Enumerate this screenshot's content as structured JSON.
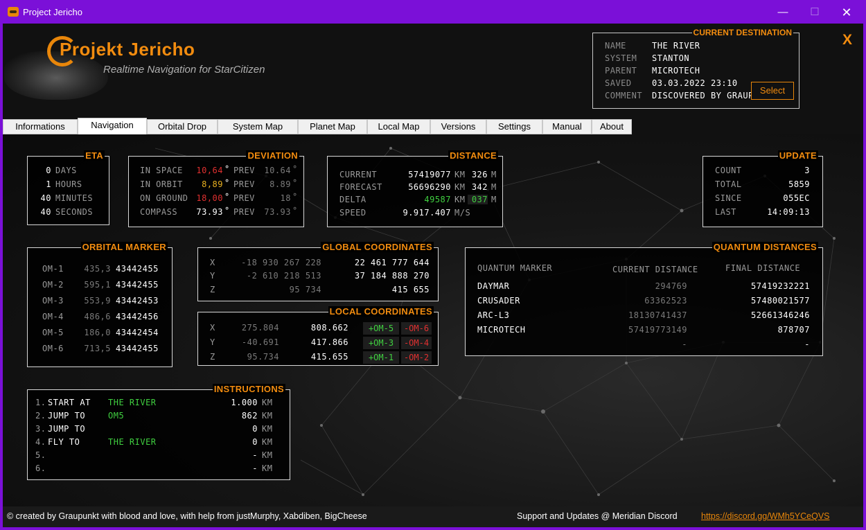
{
  "window": {
    "title": "Project Jericho",
    "min": "—",
    "max": "☐",
    "close": "✕"
  },
  "logo": {
    "title": "Projekt Jericho",
    "subtitle": "Realtime Navigation for StarCitizen"
  },
  "destination": {
    "title": "CURRENT DESTINATION",
    "rows": [
      {
        "k": "NAME",
        "v": "THE RIVER"
      },
      {
        "k": "SYSTEM",
        "v": "STANTON"
      },
      {
        "k": "PARENT",
        "v": "MICROTECH"
      },
      {
        "k": "SAVED",
        "v": "03.03.2022 23:10"
      },
      {
        "k": "COMMENT",
        "v": "DISCOVERED BY GRAUPUNKT"
      }
    ],
    "select_label": "Select",
    "close_label": "X"
  },
  "tabs": [
    "Informations",
    "Navigation",
    "Orbital Drop",
    "System Map",
    "Planet Map",
    "Local Map",
    "Versions",
    "Settings",
    "Manual",
    "About"
  ],
  "eta": {
    "title": "ETA",
    "rows": [
      {
        "n": "0",
        "u": "DAYS"
      },
      {
        "n": "1",
        "u": "HOURS"
      },
      {
        "n": "40",
        "u": "MINUTES"
      },
      {
        "n": "40",
        "u": "SECONDS"
      }
    ]
  },
  "deviation": {
    "title": "DEVIATION",
    "rows": [
      {
        "k": "IN SPACE",
        "v": "10,64",
        "prev_label": "PREV",
        "prev": "10.64",
        "unit": "°"
      },
      {
        "k": "IN ORBIT",
        "v": "8,89",
        "prev_label": "PREV",
        "prev": "8.89",
        "unit": "°"
      },
      {
        "k": "ON GROUND",
        "v": "18,00",
        "prev_label": "PREV",
        "prev": "18",
        "unit": "°"
      },
      {
        "k": "COMPASS",
        "v": "73.93",
        "prev_label": "PREV",
        "prev": "73.93",
        "unit": "°"
      }
    ]
  },
  "distance": {
    "title": "DISTANCE",
    "rows": [
      {
        "k": "CURRENT",
        "v": "57419077",
        "u1": "KM",
        "m": "326",
        "u2": "M"
      },
      {
        "k": "FORECAST",
        "v": "56696290",
        "u1": "KM",
        "m": "342",
        "u2": "M"
      },
      {
        "k": "DELTA",
        "v": "49587",
        "u1": "KM",
        "m": "037",
        "u2": "M"
      },
      {
        "k": "SPEED",
        "v": "9.917.407",
        "u1": "M/S",
        "m": "",
        "u2": ""
      }
    ]
  },
  "update": {
    "title": "UPDATE",
    "rows": [
      {
        "k": "COUNT",
        "v": "3"
      },
      {
        "k": "TOTAL",
        "v": "5859"
      },
      {
        "k": "SINCE",
        "v": "055EC"
      },
      {
        "k": "LAST",
        "v": "14:09:13"
      }
    ]
  },
  "orbital_marker": {
    "title": "ORBITAL MARKER",
    "rows": [
      {
        "k": "OM-1",
        "a": "435,3",
        "b": "43442455"
      },
      {
        "k": "OM-2",
        "a": "595,1",
        "b": "43442455"
      },
      {
        "k": "OM-3",
        "a": "553,9",
        "b": "43442453"
      },
      {
        "k": "OM-4",
        "a": "486,6",
        "b": "43442456"
      },
      {
        "k": "OM-5",
        "a": "186,0",
        "b": "43442454"
      },
      {
        "k": "OM-6",
        "a": "713,5",
        "b": "43442455"
      }
    ]
  },
  "global_coords": {
    "title": "GLOBAL COORDINATES",
    "rows": [
      {
        "k": "X",
        "a": "-18 930 267 228",
        "b": "22 461 777 644"
      },
      {
        "k": "Y",
        "a": "-2 610 218 513",
        "b": "37 184 888 270"
      },
      {
        "k": "Z",
        "a": "95 734",
        "b": "415 655"
      }
    ]
  },
  "local_coords": {
    "title": "LOCAL COORDINATES",
    "rows": [
      {
        "k": "X",
        "a": "275.804",
        "b": "808.662",
        "p": "+OM-5",
        "q": "-OM-6"
      },
      {
        "k": "Y",
        "a": "-40.691",
        "b": "417.866",
        "p": "+OM-3",
        "q": "-OM-4"
      },
      {
        "k": "Z",
        "a": "95.734",
        "b": "415.655",
        "p": "+OM-1",
        "q": "-OM-2"
      }
    ]
  },
  "quantum": {
    "title": "QUANTUM DISTANCES",
    "headers": [
      "QUANTUM MARKER",
      "CURRENT DISTANCE",
      "FINAL DISTANCE"
    ],
    "rows": [
      {
        "k": "DAYMAR",
        "a": "294769",
        "b": "57419232221"
      },
      {
        "k": "CRUSADER",
        "a": "63362523",
        "b": "57480021577"
      },
      {
        "k": "ARC-L3",
        "a": "18130741437",
        "b": "52661346246"
      },
      {
        "k": "MICROTECH",
        "a": "57419773149",
        "b": "878707"
      },
      {
        "k": "",
        "a": "-",
        "b": "-"
      }
    ]
  },
  "instructions": {
    "title": "INSTRUCTIONS",
    "rows": [
      {
        "n": "1.",
        "act": "START AT",
        "tgt": "THE RIVER",
        "d": "1.000",
        "u": "KM"
      },
      {
        "n": "2.",
        "act": "JUMP TO",
        "tgt": "OM5",
        "d": "862",
        "u": "KM"
      },
      {
        "n": "3.",
        "act": "JUMP TO",
        "tgt": "",
        "d": "0",
        "u": "KM"
      },
      {
        "n": "4.",
        "act": "FLY TO",
        "tgt": "THE RIVER",
        "d": "0",
        "u": "KM"
      },
      {
        "n": "5.",
        "act": "",
        "tgt": "",
        "d": "-",
        "u": "KM"
      },
      {
        "n": "6.",
        "act": "",
        "tgt": "",
        "d": "-",
        "u": "KM"
      }
    ]
  },
  "footer": {
    "credit": "© created by Graupunkt with blood and love, with help from justMurphy, Xabdiben, BigCheese",
    "support": "Support and Updates @ Meridian Discord",
    "link": "https://discord.gg/WMh5YCeQVS"
  },
  "colors": {
    "accent": "#f28c0f",
    "titlebar": "#7b10d8",
    "warn_red": "#e03030",
    "warn_yellow": "#e8b020",
    "ok_green": "#40d040"
  }
}
